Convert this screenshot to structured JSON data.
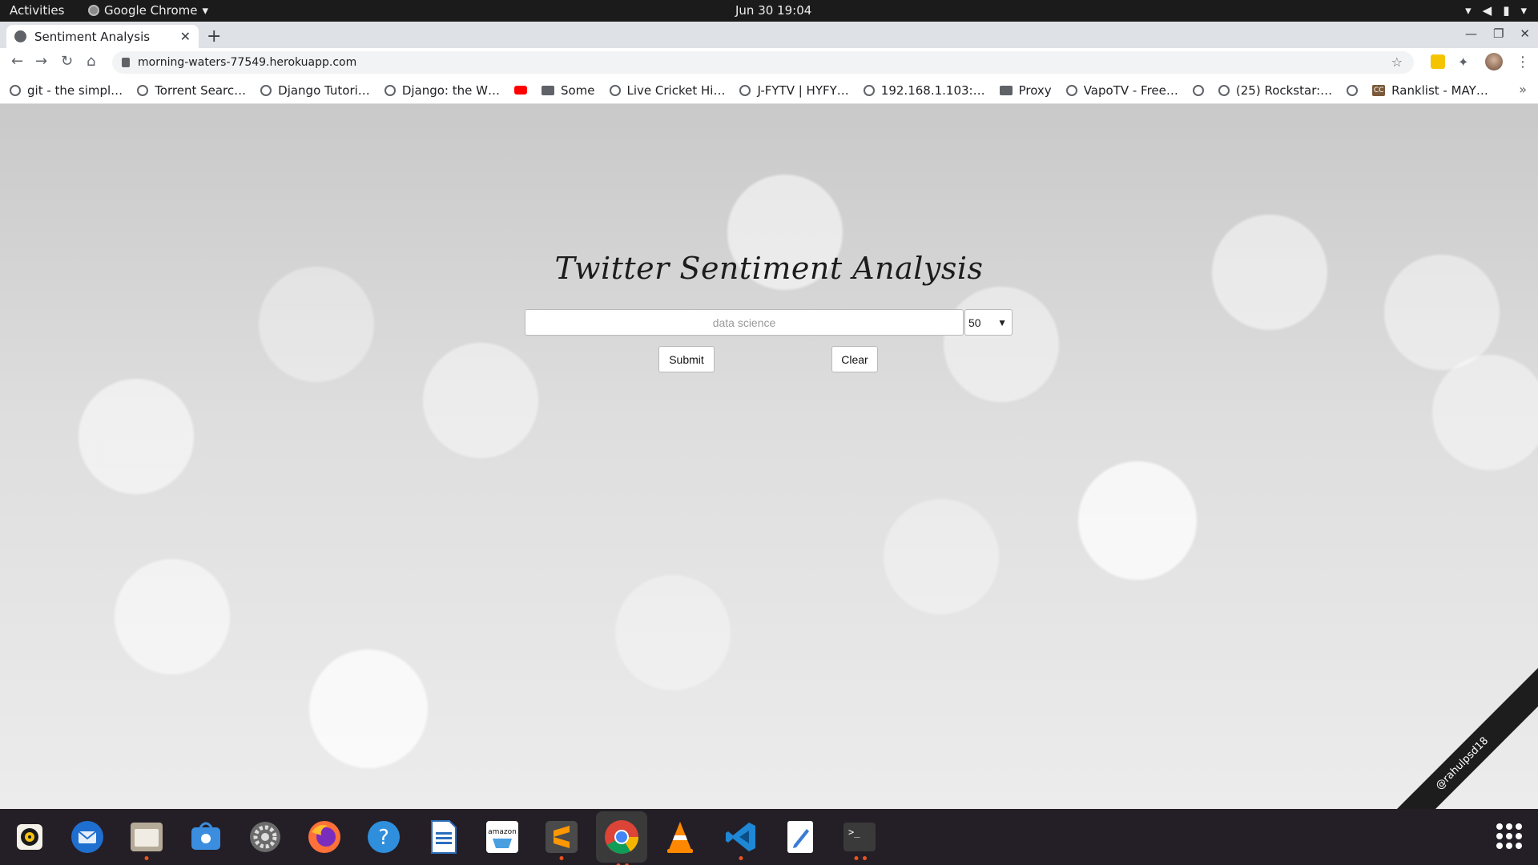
{
  "system": {
    "activities": "Activities",
    "app_menu": "Google Chrome",
    "clock": "Jun 30  19:04"
  },
  "browser": {
    "tab_title": "Sentiment Analysis",
    "url": "morning-waters-77549.herokuapp.com",
    "bookmarks": [
      "git - the simpl…",
      "Torrent Searc…",
      "Django Tutori…",
      "Django: the W…",
      "",
      "Some",
      "Live Cricket Hi…",
      "J-FYTV | HYFY…",
      "192.168.1.103:…",
      "Proxy",
      "VapoTV - Free…",
      "",
      "(25) Rockstar:…",
      "",
      "Ranklist - MAY…"
    ]
  },
  "page": {
    "heading": "Twitter Sentiment Analysis",
    "query_placeholder": "data science",
    "count_value": "50",
    "submit_label": "Submit",
    "clear_label": "Clear",
    "watermark": "@rahulpsd18"
  },
  "dock": {
    "apps": [
      "rhythmbox-icon",
      "thunderbird-icon",
      "files-icon",
      "software-icon",
      "settings-icon",
      "firefox-icon",
      "help-icon",
      "writer-icon",
      "amazon-icon",
      "sublime-icon",
      "chrome-icon",
      "vlc-icon",
      "vscode-icon",
      "text-editor-icon",
      "terminal-icon"
    ]
  }
}
